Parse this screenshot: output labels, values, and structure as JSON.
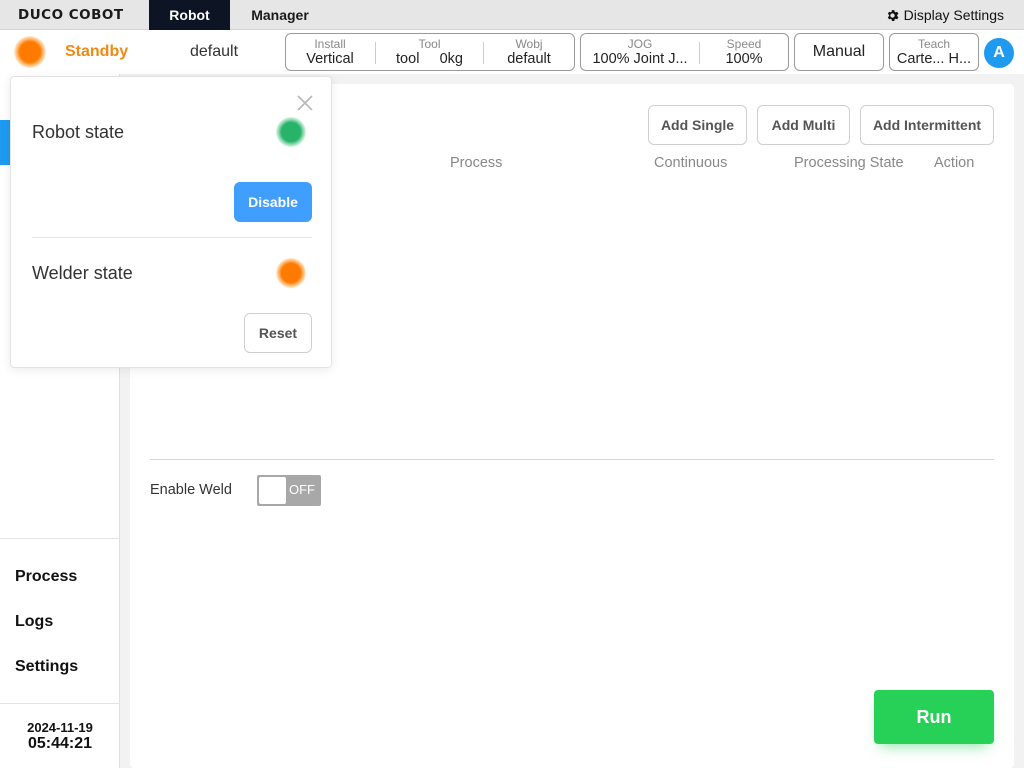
{
  "topnav": {
    "logo": "DUCO COBOT",
    "tabs": [
      "Robot",
      "Manager"
    ],
    "display_settings": "Display Settings"
  },
  "status": {
    "state": "Standby",
    "project": "default",
    "state_color": "#f08a16",
    "install": {
      "label": "Install",
      "value": "Vertical"
    },
    "tool": {
      "label": "Tool",
      "name": "tool",
      "weight": "0kg"
    },
    "wobj": {
      "label": "Wobj",
      "value": "default"
    },
    "jog": {
      "label": "JOG",
      "value": "100% Joint J..."
    },
    "speed": {
      "label": "Speed",
      "value": "100%"
    },
    "mode_button": "Manual",
    "teach": {
      "label": "Teach",
      "value": "Carte... H..."
    },
    "avatar": "A"
  },
  "sidebar": {
    "items": [
      "Process",
      "Logs",
      "Settings"
    ],
    "date": "2024-11-19",
    "time": "05:44:21"
  },
  "main": {
    "buttons": [
      "Add Single",
      "Add Multi",
      "Add Intermittent"
    ],
    "columns": [
      "Process",
      "Continuous",
      "Processing State",
      "Action"
    ],
    "enable_weld_label": "Enable Weld",
    "enable_weld_state": "OFF",
    "run_button": "Run"
  },
  "popup": {
    "robot_state_label": "Robot state",
    "robot_state_color": "#27b36a",
    "disable_button": "Disable",
    "welder_state_label": "Welder state",
    "welder_state_color": "#ff7a00",
    "reset_button": "Reset"
  }
}
